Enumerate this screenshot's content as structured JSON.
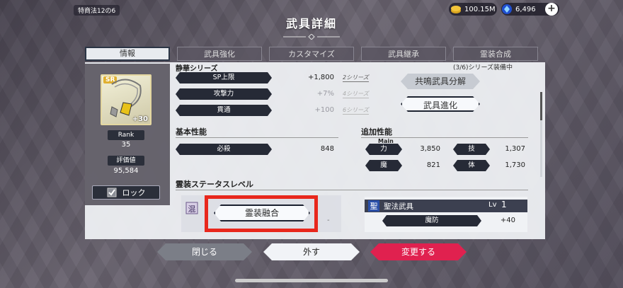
{
  "header": {
    "legal_tag": "特商法12の6",
    "title": "武具詳細",
    "gold": "100.15M",
    "gems": "6,496",
    "plus_label": "+"
  },
  "tabs": [
    "情報",
    "武具強化",
    "カスタマイズ",
    "武具継承",
    "霊装合成"
  ],
  "item": {
    "rarity": "SR",
    "level_bonus": "+30",
    "rank_label": "Rank",
    "rank_value": "35",
    "rating_label": "評価値",
    "rating_value": "95,584",
    "lock_label": "ロック"
  },
  "series": {
    "title": "静華シリーズ",
    "progress_note": "(3/6)シリーズ装備中",
    "rows": [
      {
        "stat": "SP上限",
        "value": "+1,800",
        "tier": "2シリーズ",
        "active": true
      },
      {
        "stat": "攻撃力",
        "value": "+7%",
        "tier": "4シリーズ",
        "active": false
      },
      {
        "stat": "貫通",
        "value": "+100",
        "tier": "6シリーズ",
        "active": false
      }
    ]
  },
  "actions": {
    "resonance_disassemble": "共鳴武具分解",
    "evolve": "武具進化"
  },
  "base_stats": {
    "title": "基本性能",
    "rows": [
      {
        "stat": "必殺",
        "value": "848"
      }
    ]
  },
  "extra_stats": {
    "title": "追加性能",
    "main_tag": "Main",
    "rows": [
      {
        "stat": "力",
        "value": "3,850"
      },
      {
        "stat": "技",
        "value": "1,307"
      },
      {
        "stat": "魔",
        "value": "821"
      },
      {
        "stat": "体",
        "value": "1,730"
      }
    ]
  },
  "spirit": {
    "title": "霊装ステータスレベル",
    "merge_button": "霊装融合",
    "dash": "-"
  },
  "weapon": {
    "icon_char": "聖",
    "name": "聖法武具",
    "lv_label": "Lv",
    "lv_value": "1",
    "stat": "魔防",
    "stat_value": "+40"
  },
  "footer": {
    "close": "閉じる",
    "remove": "外す",
    "change": "変更する"
  },
  "colors": {
    "highlight_frame": "#e8271c",
    "change_button": "#e0214f"
  }
}
